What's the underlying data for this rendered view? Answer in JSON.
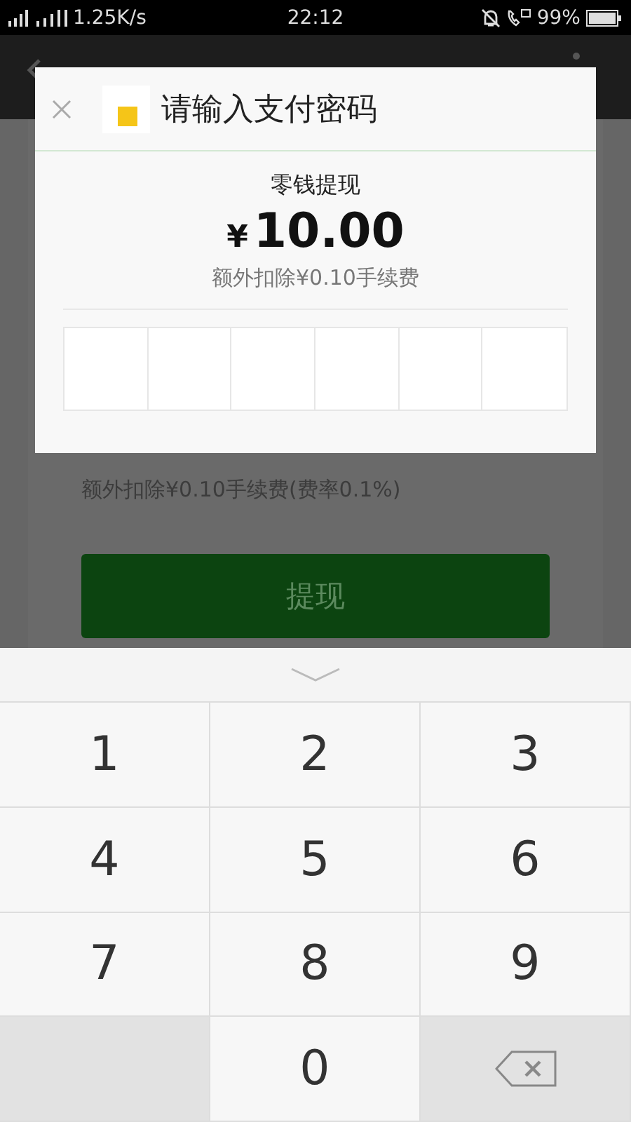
{
  "status_bar": {
    "network_speed": "1.25K/s",
    "time": "22:12",
    "battery": "99%"
  },
  "background_page": {
    "fee_note": "额外扣除¥0.10手续费(费率0.1%)",
    "submit_button": "提现"
  },
  "dialog": {
    "title": "请输入支付密码",
    "purpose": "零钱提现",
    "currency": "¥",
    "amount": "10.00",
    "fee": "额外扣除¥0.10手续费",
    "password_boxes": [
      {
        "filled": false
      },
      {
        "filled": false
      },
      {
        "filled": false
      },
      {
        "filled": false
      },
      {
        "filled": false
      },
      {
        "filled": false
      }
    ]
  },
  "keypad": {
    "keys": [
      {
        "kind": "digit",
        "label": "1"
      },
      {
        "kind": "digit",
        "label": "2"
      },
      {
        "kind": "digit",
        "label": "3"
      },
      {
        "kind": "digit",
        "label": "4"
      },
      {
        "kind": "digit",
        "label": "5"
      },
      {
        "kind": "digit",
        "label": "6"
      },
      {
        "kind": "digit",
        "label": "7"
      },
      {
        "kind": "digit",
        "label": "8"
      },
      {
        "kind": "digit",
        "label": "9"
      },
      {
        "kind": "blank"
      },
      {
        "kind": "digit",
        "label": "0"
      },
      {
        "kind": "backspace"
      }
    ]
  }
}
